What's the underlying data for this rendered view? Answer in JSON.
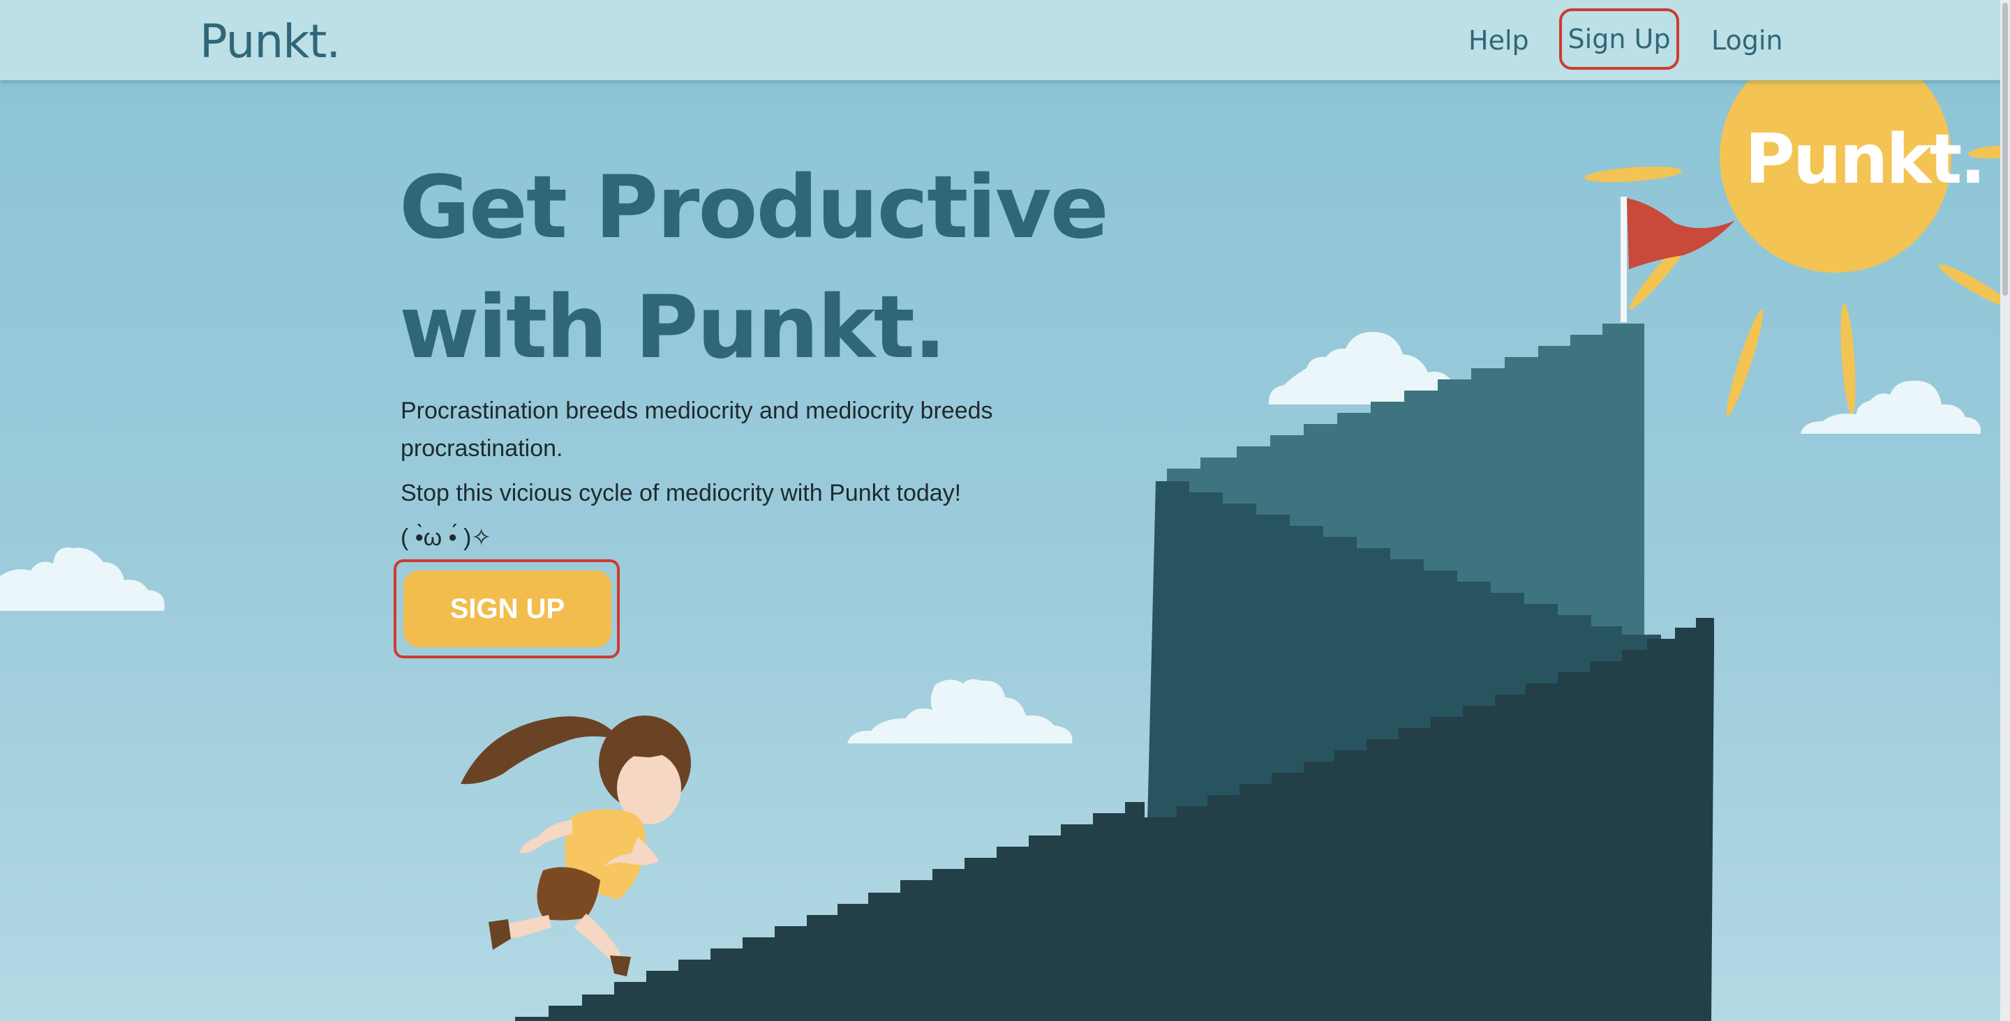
{
  "nav": {
    "brand": "Punkt.",
    "links": [
      {
        "label": "Help"
      },
      {
        "label": "Sign Up"
      },
      {
        "label": "Login"
      }
    ]
  },
  "hero": {
    "title": "Get Productive with Punkt.",
    "paragraph_1": "Procrastination breeds mediocrity and mediocrity breeds procrastination.",
    "paragraph_2": "Stop this vicious cycle of mediocrity with Punkt today!",
    "emoticon": "( •̀ω •́ )✧",
    "cta_label": "SIGN UP"
  },
  "illustration": {
    "sun_text": "Punkt.",
    "colors": {
      "sun": "#f3c453",
      "flag": "#c9493b",
      "stairs_dark": "#233f47",
      "stairs_mid": "#285460",
      "stairs_light": "#3d7480",
      "cloud": "#eaf6f9"
    }
  }
}
